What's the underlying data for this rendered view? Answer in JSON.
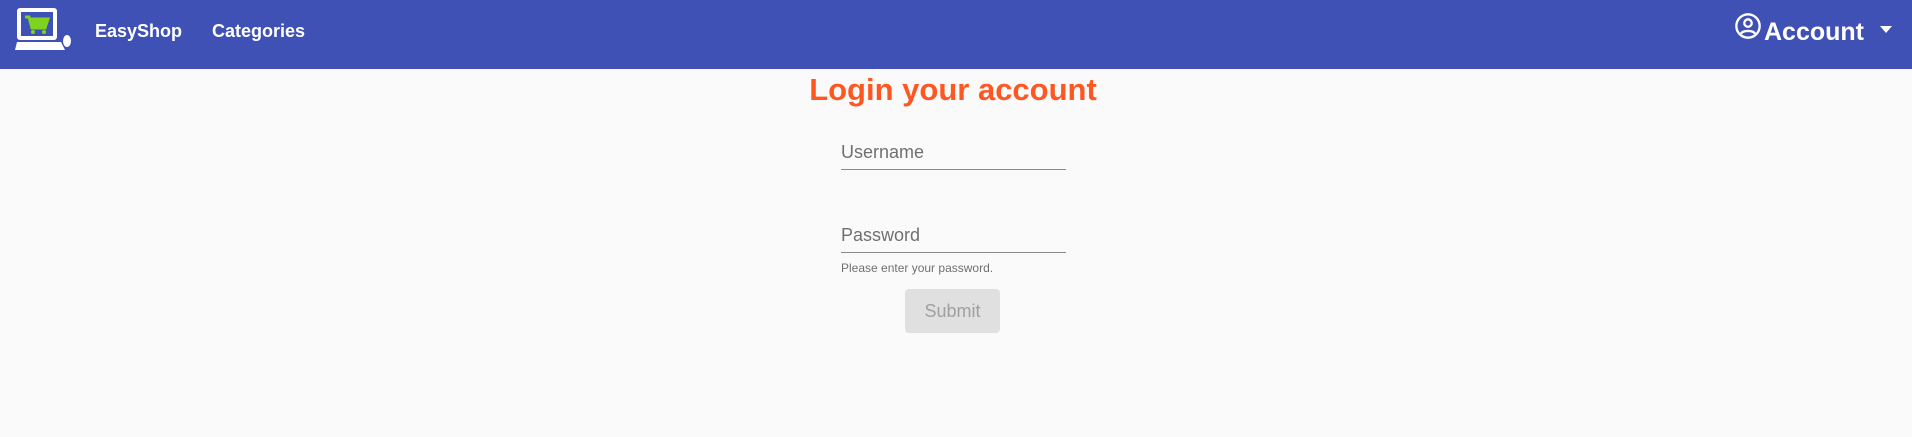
{
  "header": {
    "brand_label": "EasyShop",
    "categories_label": "Categories",
    "account_label": "Account",
    "background": "#3f51b5"
  },
  "login": {
    "title": "Login your account",
    "title_color": "#ff5722",
    "username_placeholder": "Username",
    "username_value": "",
    "password_placeholder": "Password",
    "password_value": "",
    "password_hint": "Please enter your password.",
    "submit_label": "Submit",
    "submit_disabled": true
  },
  "icons": {
    "logo": "shopping-cart-computer-icon",
    "account": "account-circle-icon",
    "caret": "caret-down-icon"
  }
}
